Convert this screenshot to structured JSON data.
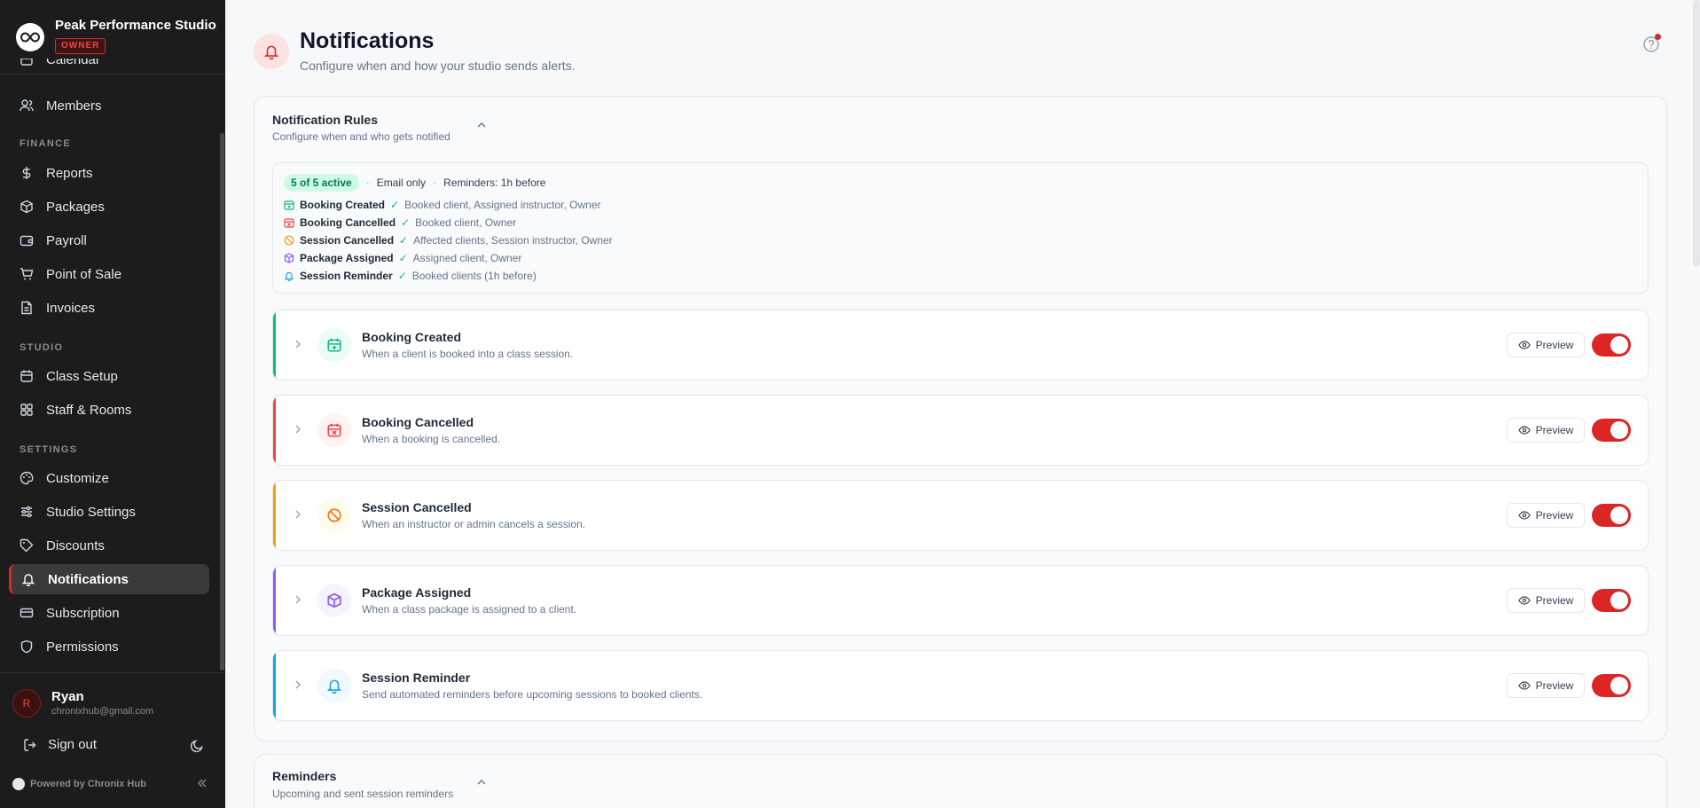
{
  "brand": {
    "name": "Peak Performance Studio",
    "role": "OWNER"
  },
  "sidebar": {
    "items": [
      {
        "label": "Calendar"
      },
      {
        "label": "Members"
      },
      {
        "section": "FINANCE"
      },
      {
        "label": "Reports"
      },
      {
        "label": "Packages"
      },
      {
        "label": "Payroll"
      },
      {
        "label": "Point of Sale"
      },
      {
        "label": "Invoices"
      },
      {
        "section": "STUDIO"
      },
      {
        "label": "Class Setup"
      },
      {
        "label": "Staff & Rooms"
      },
      {
        "section": "SETTINGS"
      },
      {
        "label": "Customize"
      },
      {
        "label": "Studio Settings"
      },
      {
        "label": "Discounts"
      },
      {
        "label": "Notifications",
        "active": true
      },
      {
        "label": "Subscription"
      },
      {
        "label": "Permissions"
      }
    ]
  },
  "user": {
    "initial": "R",
    "name": "Ryan",
    "email": "chronixhub@gmail.com",
    "signout": "Sign out"
  },
  "powered_by": "Powered by Chronix Hub",
  "page": {
    "title": "Notifications",
    "subtitle": "Configure when and how your studio sends alerts."
  },
  "rules_panel": {
    "title": "Notification Rules",
    "subtitle": "Configure when and who gets notified",
    "summary": {
      "active": "5 of 5 active",
      "channel": "Email only",
      "reminders": "Reminders: 1h before",
      "rows": [
        {
          "name": "Booking Created",
          "recipients": "Booked client, Assigned instructor, Owner"
        },
        {
          "name": "Booking Cancelled",
          "recipients": "Booked client, Owner"
        },
        {
          "name": "Session Cancelled",
          "recipients": "Affected clients, Session instructor, Owner"
        },
        {
          "name": "Package Assigned",
          "recipients": "Assigned client, Owner"
        },
        {
          "name": "Session Reminder",
          "recipients": "Booked clients (1h before)"
        }
      ]
    },
    "rules": [
      {
        "title": "Booking Created",
        "description": "When a client is booked into a class session.",
        "preview": "Preview",
        "enabled": true
      },
      {
        "title": "Booking Cancelled",
        "description": "When a booking is cancelled.",
        "preview": "Preview",
        "enabled": true
      },
      {
        "title": "Session Cancelled",
        "description": "When an instructor or admin cancels a session.",
        "preview": "Preview",
        "enabled": true
      },
      {
        "title": "Package Assigned",
        "description": "When a class package is assigned to a client.",
        "preview": "Preview",
        "enabled": true
      },
      {
        "title": "Session Reminder",
        "description": "Send automated reminders before upcoming sessions to booked clients.",
        "preview": "Preview",
        "enabled": true
      }
    ]
  },
  "reminders_panel": {
    "title": "Reminders",
    "subtitle": "Upcoming and sent session reminders"
  },
  "colors": {
    "accent": "#dc2626",
    "sidebar_bg": "#1c1c1c",
    "booking_created": "#10b981",
    "booking_cancelled": "#ef4444",
    "session_cancelled": "#f59e0b",
    "package_assigned": "#8b5cf6",
    "session_reminder": "#0ea5e9"
  }
}
